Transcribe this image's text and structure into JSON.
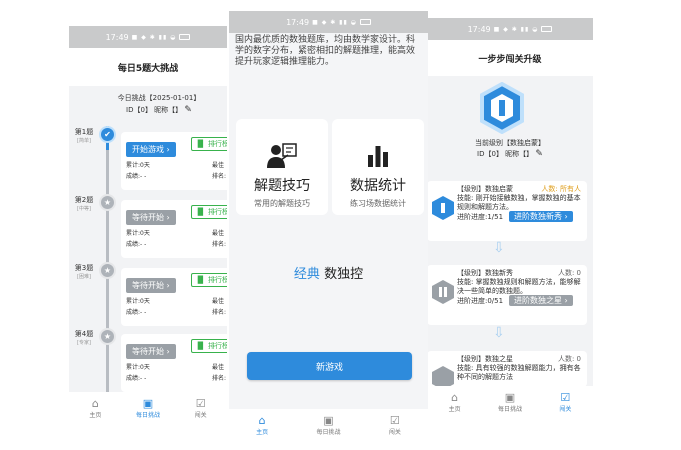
{
  "status_time": "17:49",
  "phone1": {
    "title": "每日5题大挑战",
    "challenge_label": "今日挑战【2025-01-01】",
    "id_label": "ID【0】 昵称【】",
    "questions": [
      {
        "label": "第1题",
        "difficulty": "[简单]",
        "button": "开始游戏 ›",
        "state": "active",
        "total": "累计:0天",
        "score": "成绩:- -",
        "best": "最佳",
        "rank": "排名:"
      },
      {
        "label": "第2题",
        "difficulty": "[中等]",
        "button": "等待开始 ›",
        "state": "wait",
        "total": "累计:0天",
        "score": "成绩:- -",
        "best": "最佳",
        "rank": "排名:"
      },
      {
        "label": "第3题",
        "difficulty": "[困难]",
        "button": "等待开始 ›",
        "state": "wait",
        "total": "累计:0天",
        "score": "成绩:- -",
        "best": "最佳",
        "rank": "排名:"
      },
      {
        "label": "第4题",
        "difficulty": "[专家]",
        "button": "等待开始 ›",
        "state": "wait",
        "total": "累计:0天",
        "score": "成绩:- -",
        "best": "最佳",
        "rank": "排名:"
      }
    ],
    "rank_button": "排行榜",
    "tabs": [
      "主页",
      "每日挑战",
      "闯关"
    ]
  },
  "phone2": {
    "intro": "国内最优质的数独题库，均由数学家设计。科学的数字分布，紧密相扣的解题推理，能高效提升玩家逻辑推理能力。",
    "features": [
      {
        "title": "解题技巧",
        "subtitle": "常用的解题技巧"
      },
      {
        "title": "数据统计",
        "subtitle": "练习场数据统计"
      }
    ],
    "classic_a": "经典",
    "classic_b": " 数独控",
    "new_game": "新游戏",
    "tabs": [
      "主页",
      "每日挑战",
      "闯关"
    ]
  },
  "phone3": {
    "title": "一步步闯关升级",
    "level_label": "当前级别【数独启蒙】",
    "id_label": "ID【0】 昵称【】",
    "levels": [
      {
        "head": "【级别】数独启蒙",
        "count": "人数: 所有人",
        "skill": "技能: 刚开始接触数独，掌握数独的基本规则和解题方法。",
        "progress": "进阶进度:1/51",
        "button": "进阶数独新秀 ›"
      },
      {
        "head": "【级别】数独新秀",
        "count": "人数: 0",
        "skill": "技能: 掌握数独规则和解题方法，能够解决一些简单的数独题。",
        "progress": "进阶进度:0/51",
        "button": "进阶数独之星 ›"
      },
      {
        "head": "【级别】数独之星",
        "count": "人数: 0",
        "skill": "技能: 具有较强的数独解题能力，拥有各种不同的解题方法",
        "progress": "",
        "button": ""
      }
    ],
    "tabs": [
      "主页",
      "每日挑战",
      "闯关"
    ]
  },
  "colors": {
    "accent": "#2e8bdc",
    "green": "#38b24c",
    "grey": "#9aa0a6",
    "gold": "#e0a020"
  }
}
